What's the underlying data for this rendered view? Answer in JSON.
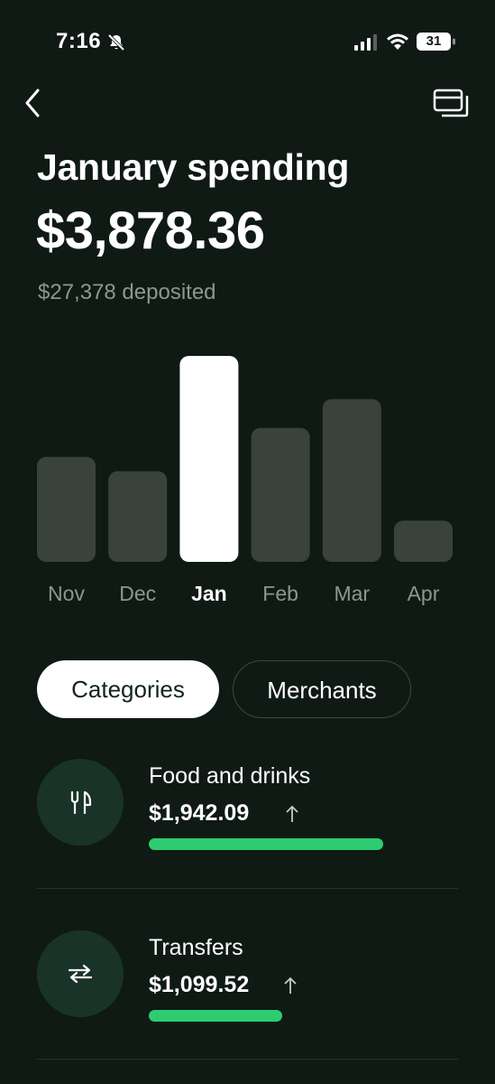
{
  "status_bar": {
    "time": "7:16",
    "battery": "31",
    "icons": [
      "bell-slash-icon",
      "signal-icon",
      "wifi-icon",
      "battery-icon"
    ]
  },
  "nav": {
    "back_icon": "chevron-left-icon",
    "cards_icon": "cards-icon"
  },
  "header": {
    "title": "January spending",
    "amount": "$3,878.36",
    "deposited": "$27,378 deposited"
  },
  "chart_data": {
    "type": "bar",
    "categories": [
      "Nov",
      "Dec",
      "Jan",
      "Feb",
      "Mar",
      "Apr"
    ],
    "values": [
      0.51,
      0.44,
      1.0,
      0.65,
      0.79,
      0.2
    ],
    "selected": "Jan",
    "colors": {
      "bar": "#3a423e",
      "selected_bar": "#ffffff",
      "label": "#8a9990",
      "selected_label": "#ffffff"
    }
  },
  "tabs": {
    "categories_label": "Categories",
    "merchants_label": "Merchants",
    "active": "Categories"
  },
  "categories": [
    {
      "name": "Food and drinks",
      "amount": "$1,942.09",
      "icon": "fork-knife-icon",
      "trend": "up",
      "fraction": 1.0
    },
    {
      "name": "Transfers",
      "amount": "$1,099.52",
      "icon": "transfer-arrows-icon",
      "trend": "up",
      "fraction": 0.57
    }
  ],
  "theme": {
    "background": "#0f1a15",
    "accent": "#2ecc71",
    "muted_text": "#8a9990"
  }
}
